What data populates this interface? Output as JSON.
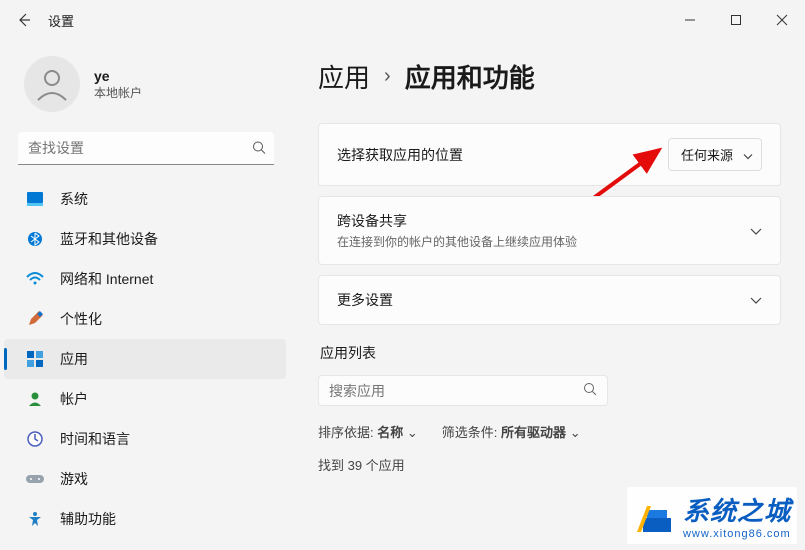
{
  "window": {
    "title": "设置"
  },
  "user": {
    "name": "ye",
    "subtitle": "本地帐户"
  },
  "search": {
    "placeholder": "查找设置"
  },
  "sidebar": {
    "items": [
      {
        "label": "系统",
        "icon": "system-icon",
        "color": "#0078d4"
      },
      {
        "label": "蓝牙和其他设备",
        "icon": "bluetooth-icon",
        "color": "#0078d4"
      },
      {
        "label": "网络和 Internet",
        "icon": "wifi-icon",
        "color": "#0a8bd6"
      },
      {
        "label": "个性化",
        "icon": "personalization-icon",
        "color": "#d06a3a"
      },
      {
        "label": "应用",
        "icon": "apps-icon",
        "color": "#0067c0",
        "active": true
      },
      {
        "label": "帐户",
        "icon": "accounts-icon",
        "color": "#2a8f3a"
      },
      {
        "label": "时间和语言",
        "icon": "time-language-icon",
        "color": "#4a5fbc"
      },
      {
        "label": "游戏",
        "icon": "gaming-icon",
        "color": "#7b8894"
      },
      {
        "label": "辅助功能",
        "icon": "accessibility-icon",
        "color": "#1f7fc4"
      }
    ]
  },
  "breadcrumb": {
    "parent": "应用",
    "current": "应用和功能"
  },
  "settings": {
    "source": {
      "label": "选择获取应用的位置",
      "value": "任何来源"
    },
    "share": {
      "label": "跨设备共享",
      "sub": "在连接到你的帐户的其他设备上继续应用体验"
    },
    "more": {
      "label": "更多设置"
    }
  },
  "applist": {
    "title": "应用列表",
    "search_placeholder": "搜索应用",
    "sort_label": "排序依据:",
    "sort_value": "名称",
    "filter_label": "筛选条件:",
    "filter_value": "所有驱动器",
    "count_text": "找到 39 个应用"
  },
  "watermark": {
    "brand": "系统之城",
    "url": "www.xitong86.com"
  }
}
